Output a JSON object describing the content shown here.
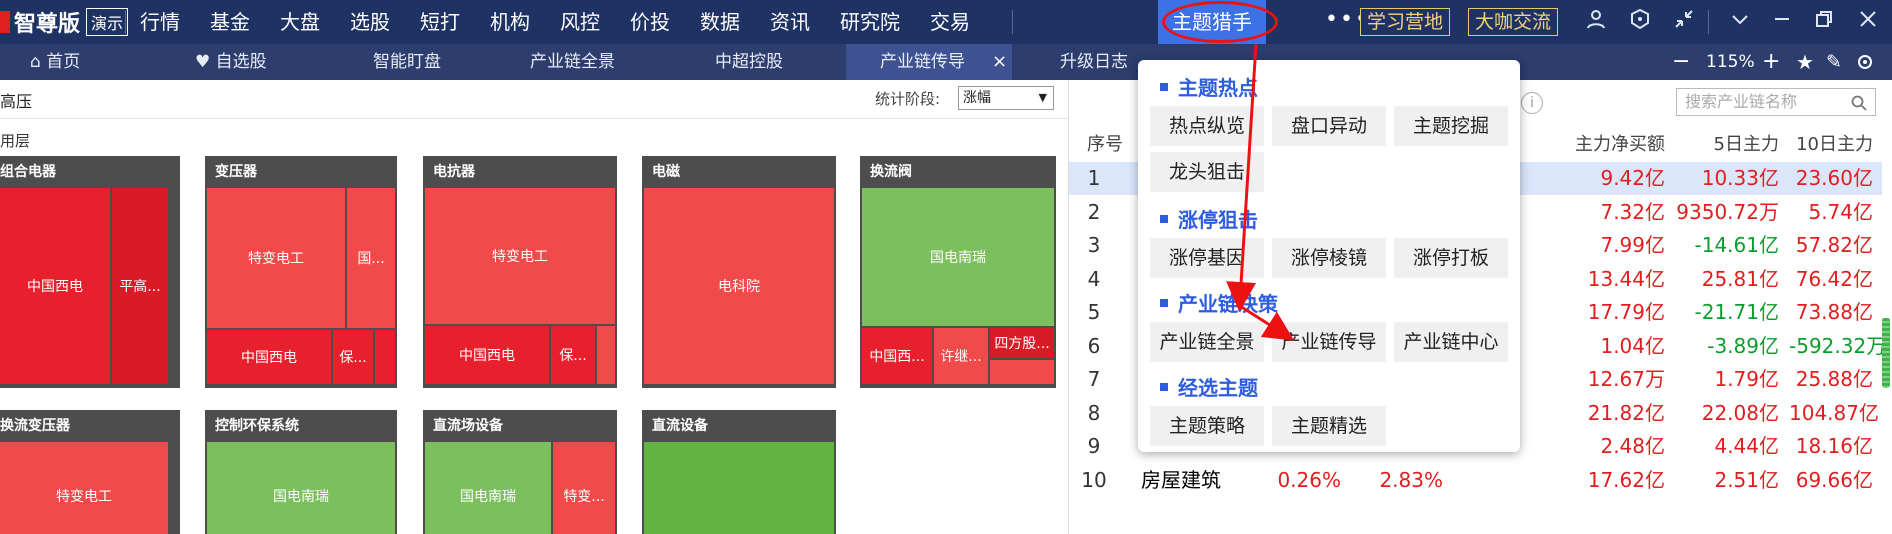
{
  "topbar": {
    "app_name": "智尊版",
    "demo_badge": "演示",
    "menu": [
      "行情",
      "基金",
      "大盘",
      "选股",
      "短打",
      "机构",
      "风控",
      "价投",
      "数据",
      "资讯",
      "研究院",
      "交易",
      "主题猎手"
    ],
    "more": "•••",
    "study_button": "学习营地",
    "chat_button": "大咖交流",
    "icons": [
      "user-icon",
      "shield-icon",
      "compress-icon",
      "chevron-down-icon",
      "minimize-icon",
      "restore-icon",
      "close-icon"
    ]
  },
  "tabbar": {
    "tabs": [
      "首页",
      "自选股",
      "智能盯盘",
      "产业链全景",
      "中超控股",
      "产业链传导",
      "升级日志"
    ],
    "close": "×",
    "zoom_out": "−",
    "zoom_level": "115%",
    "zoom_in": "+",
    "star": "★",
    "edit": "✎"
  },
  "left_panel": {
    "title": "高压",
    "stat_label": "统计阶段:",
    "stat_value": "涨幅",
    "layer_label": "用层"
  },
  "treemap": [
    {
      "title": "组合电器",
      "cells": [
        "中国西电",
        "平高..."
      ]
    },
    {
      "title": "变压器",
      "cells": [
        "特变电工",
        "国...",
        "中国西电",
        "保..."
      ]
    },
    {
      "title": "电抗器",
      "cells": [
        "特变电工",
        "中国西电",
        "保..."
      ]
    },
    {
      "title": "电磁",
      "cells": [
        "电科院"
      ]
    },
    {
      "title": "换流阀",
      "cells": [
        "国电南瑞",
        "中国西...",
        "许继...",
        "四方股..."
      ]
    },
    {
      "title": "换流变压器",
      "cells": [
        "特变电工"
      ]
    },
    {
      "title": "控制环保系统",
      "cells": [
        "国电南瑞"
      ]
    },
    {
      "title": "直流场设备",
      "cells": [
        "国电南瑞",
        "特变..."
      ]
    },
    {
      "title": "直流设备",
      "cells": []
    }
  ],
  "right_panel": {
    "search_placeholder": "搜索产业链名称",
    "info_icon": "i",
    "headers": {
      "index": "序号",
      "main_net": "主力净买额",
      "d5": "5日主力",
      "d10": "10日主力"
    },
    "rows": [
      {
        "index": "1",
        "name": "",
        "chg": "",
        "chg2": "",
        "net": "9.42亿",
        "d5": "10.33亿",
        "d10": "23.60亿"
      },
      {
        "index": "2",
        "name": "",
        "chg": "",
        "chg2": "",
        "net": "7.32亿",
        "d5": "9350.72万",
        "d10": "5.74亿"
      },
      {
        "index": "3",
        "name": "",
        "chg": "",
        "chg2": "",
        "net": "7.99亿",
        "d5": "-14.61亿",
        "d10": "57.82亿"
      },
      {
        "index": "4",
        "name": "",
        "chg": "",
        "chg2": "",
        "net": "13.44亿",
        "d5": "25.81亿",
        "d10": "76.42亿"
      },
      {
        "index": "5",
        "name": "",
        "chg": "",
        "chg2": "",
        "net": "17.79亿",
        "d5": "-21.71亿",
        "d10": "73.88亿"
      },
      {
        "index": "6",
        "name": "",
        "chg": "",
        "chg2": "",
        "net": "1.04亿",
        "d5": "-3.89亿",
        "d10": "-592.32万"
      },
      {
        "index": "7",
        "name": "",
        "chg": "",
        "chg2": "",
        "net": "12.67万",
        "d5": "1.79亿",
        "d10": "25.88亿"
      },
      {
        "index": "8",
        "name": "",
        "chg": "",
        "chg2": "",
        "net": "21.82亿",
        "d5": "22.08亿",
        "d10": "104.87亿"
      },
      {
        "index": "9",
        "name": "",
        "chg": "",
        "chg2": "",
        "net": "2.48亿",
        "d5": "4.44亿",
        "d10": "18.16亿"
      },
      {
        "index": "10",
        "name": "房屋建筑",
        "chg": "0.26%",
        "chg2": "2.83%",
        "net": "17.62亿",
        "d5": "2.51亿",
        "d10": "69.66亿"
      }
    ]
  },
  "dropdown": {
    "sections": [
      {
        "title": "主题热点",
        "items": [
          "热点纵览",
          "盘口异动",
          "主题挖掘",
          "龙头狙击"
        ]
      },
      {
        "title": "涨停狙击",
        "items": [
          "涨停基因",
          "涨停棱镜",
          "涨停打板"
        ]
      },
      {
        "title": "产业链决策",
        "items": [
          "产业链全景",
          "产业链传导",
          "产业链中心"
        ]
      },
      {
        "title": "经选主题",
        "items": [
          "主题策略",
          "主题精选"
        ]
      }
    ]
  },
  "colors": {
    "topbar": "#1f3264",
    "tabbar": "#2c3d6e",
    "active": "#3d72e6",
    "accent_blue": "#2f5de0",
    "up_red": "#e21d1d",
    "down_green": "#0d9d2b"
  }
}
